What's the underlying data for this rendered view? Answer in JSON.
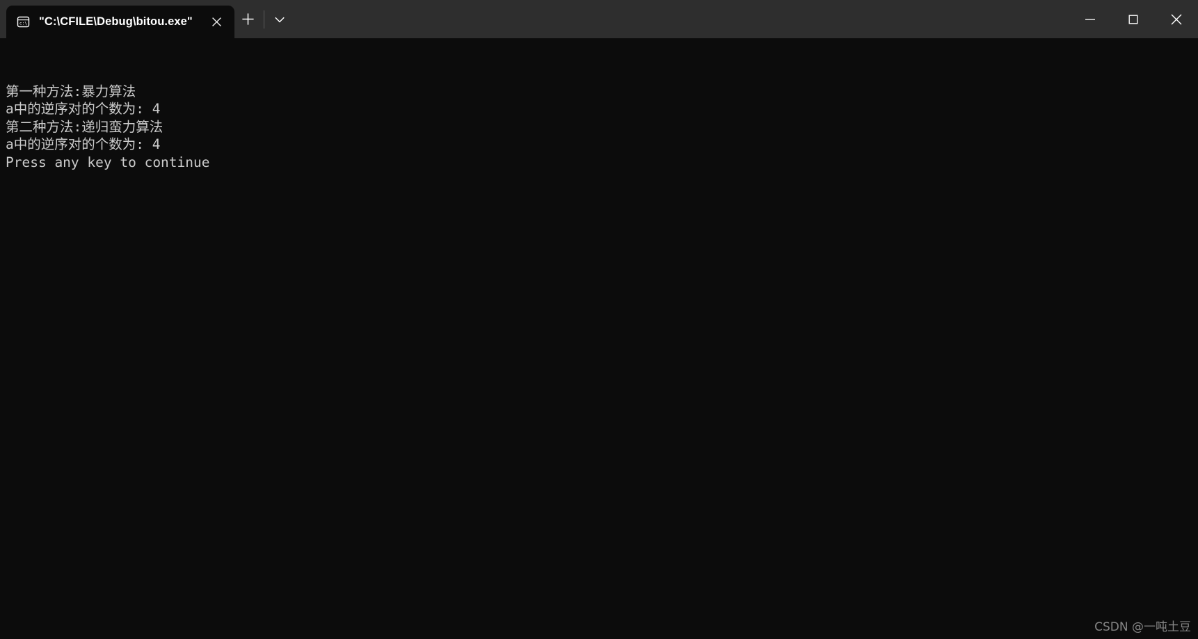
{
  "window": {
    "titlebar_color": "#2e2e2e",
    "terminal_background": "#0c0c0c",
    "terminal_foreground": "#cccccc"
  },
  "tabs": [
    {
      "icon": "console-cmd-icon",
      "icon_label": "C:\\",
      "title": "\"C:\\CFILE\\Debug\\bitou.exe\"",
      "close_label": "✕",
      "active": true
    }
  ],
  "tab_tools": {
    "new_tab_label": "+",
    "dropdown_label": "⌄"
  },
  "caption_buttons": {
    "minimize_label": "—",
    "maximize_label": "☐",
    "close_label": "✕"
  },
  "terminal": {
    "lines": [
      "第一种方法:暴力算法",
      "a中的逆序对的个数为: 4",
      "第二种方法:递归蛮力算法",
      "a中的逆序对的个数为: 4",
      "Press any key to continue"
    ],
    "text": "第一种方法:暴力算法\na中的逆序对的个数为: 4\n第二种方法:递归蛮力算法\na中的逆序对的个数为: 4\nPress any key to continue"
  },
  "watermark": {
    "text": "CSDN @一吨土豆"
  }
}
